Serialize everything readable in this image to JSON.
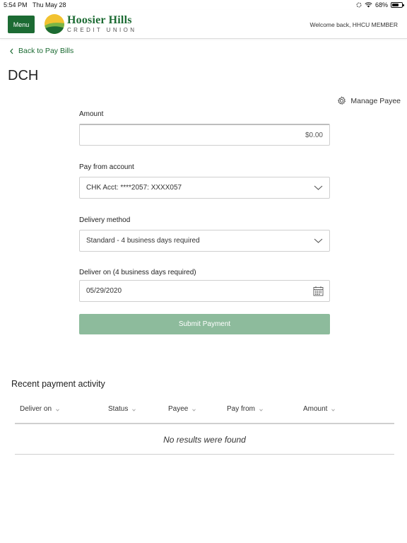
{
  "status_bar": {
    "time": "5:54 PM",
    "date": "Thu May 28",
    "battery": "68%"
  },
  "header": {
    "menu_label": "Menu",
    "logo_name": "Hoosier Hills",
    "logo_sub": "CREDIT UNION",
    "welcome": "Welcome back, HHCU MEMBER"
  },
  "nav": {
    "back_label": "Back to Pay Bills"
  },
  "page": {
    "title": "DCH",
    "manage_payee": "Manage Payee"
  },
  "form": {
    "amount_label": "Amount",
    "amount_placeholder": "$0.00",
    "pay_from_label": "Pay from account",
    "pay_from_value": "CHK Acct: ****2057: XXXX057",
    "delivery_label": "Delivery method",
    "delivery_value": "Standard - 4 business days required",
    "deliver_on_label": "Deliver on (4 business days required)",
    "deliver_on_value": "05/29/2020",
    "submit_label": "Submit Payment"
  },
  "recent": {
    "title": "Recent payment activity",
    "columns": [
      "Deliver on",
      "Status",
      "Payee",
      "Pay from",
      "Amount"
    ],
    "empty_text": "No results were found"
  },
  "colors": {
    "brand_green": "#1c6b33",
    "submit_disabled": "#8dbb9c"
  }
}
